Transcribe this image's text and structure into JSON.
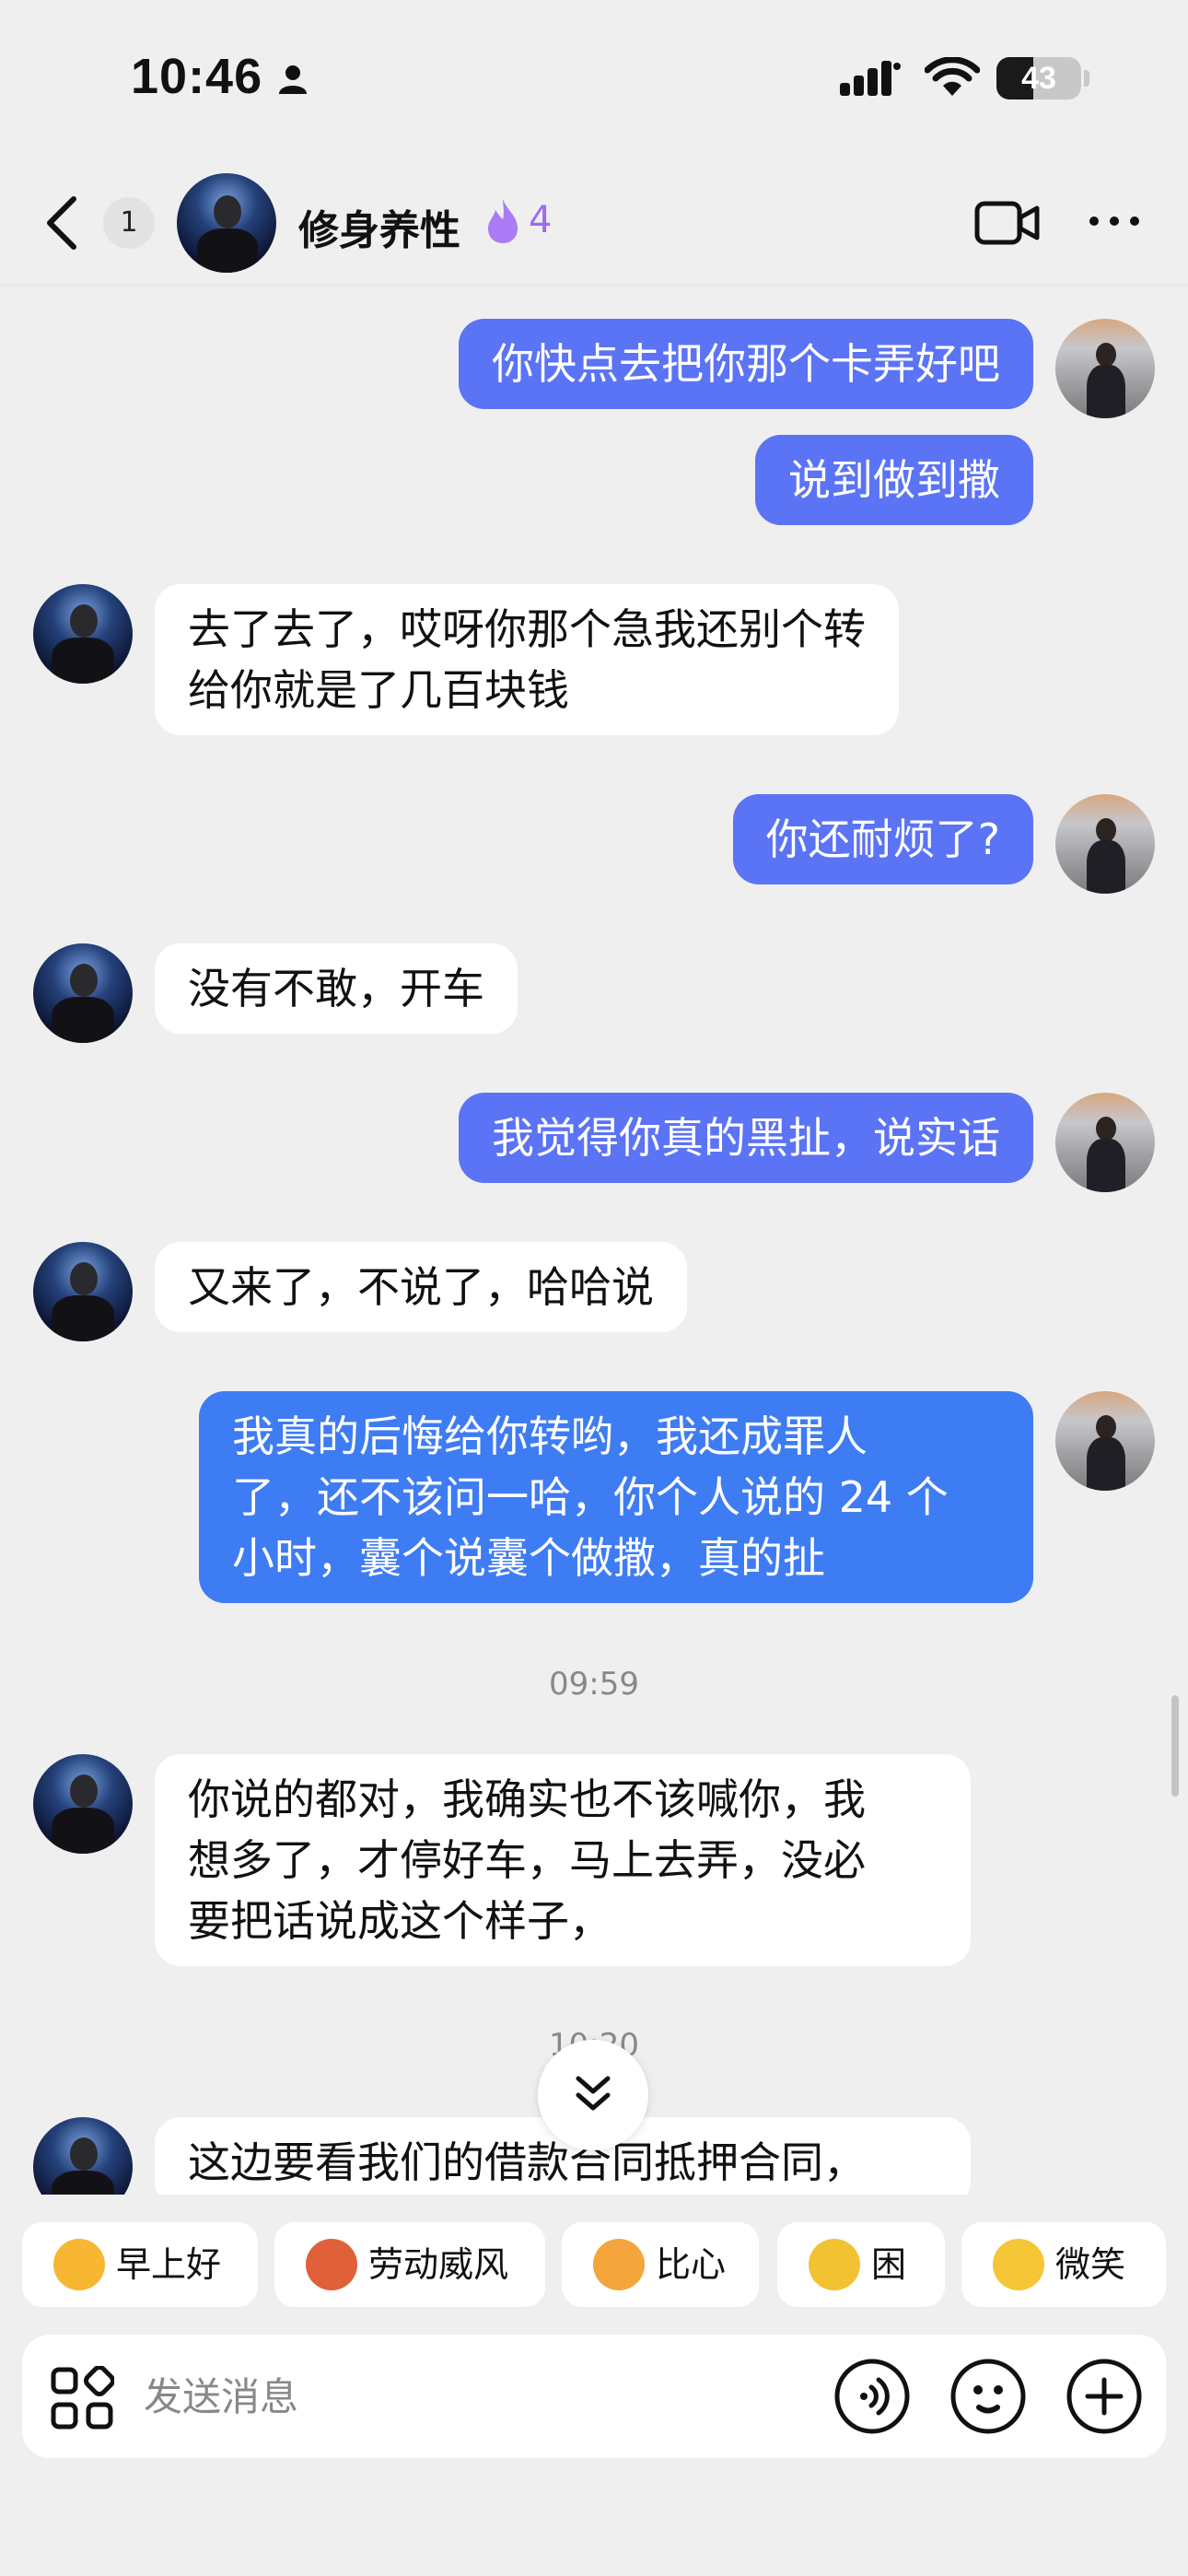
{
  "status_bar": {
    "time": "10:46",
    "battery": "43",
    "battery_level": 0.43
  },
  "header": {
    "unread_count": "1",
    "contact_name": "修身养性",
    "streak": "4"
  },
  "messages": [
    {
      "side": "out",
      "text": "你快点去把你那个卡弄好吧"
    },
    {
      "side": "out",
      "text": "说到做到撒"
    },
    {
      "side": "in",
      "text": "去了去了，哎呀你那个急我还别个转\n给你就是了几百块钱"
    },
    {
      "side": "out",
      "text": "你还耐烦了?"
    },
    {
      "side": "in",
      "text": "没有不敢，开车"
    },
    {
      "side": "out",
      "text": "我觉得你真的黑扯，说实话"
    },
    {
      "side": "in",
      "text": "又来了，不说了，哈哈说"
    },
    {
      "side": "out",
      "text": "我真的后悔给你转哟，我还成罪人\n了，还不该问一哈，你个人说的 24 个\n小时，囊个说囊个做撒，真的扯"
    },
    {
      "side": "time",
      "text": "09:59"
    },
    {
      "side": "in",
      "text": "你说的都对，我确实也不该喊你，我\n想多了，才停好车，马上去弄，没必\n要把话说成这个样子，"
    },
    {
      "side": "time",
      "text": "10:20"
    },
    {
      "side": "in",
      "text": "这边要看我们的借款合同抵押合同，"
    }
  ],
  "quick_replies": [
    {
      "label": "早上好",
      "icon": "sun-face-emoji",
      "color": "#f7b733"
    },
    {
      "label": "劳动威风",
      "icon": "crab-emoji",
      "color": "#e0603a"
    },
    {
      "label": "比心",
      "icon": "heart-hand-emoji",
      "color": "#f4a63c"
    },
    {
      "label": "困",
      "icon": "sleepy-face-emoji",
      "color": "#f2c232"
    },
    {
      "label": "微笑",
      "icon": "smile-face-emoji",
      "color": "#f5c636"
    }
  ],
  "input": {
    "placeholder": "发送消息"
  },
  "colors": {
    "outgoing": "#5b73f5",
    "outgoing_alt": "#3e7cf4",
    "incoming": "#ffffff",
    "accent": "#9b6cf0"
  }
}
